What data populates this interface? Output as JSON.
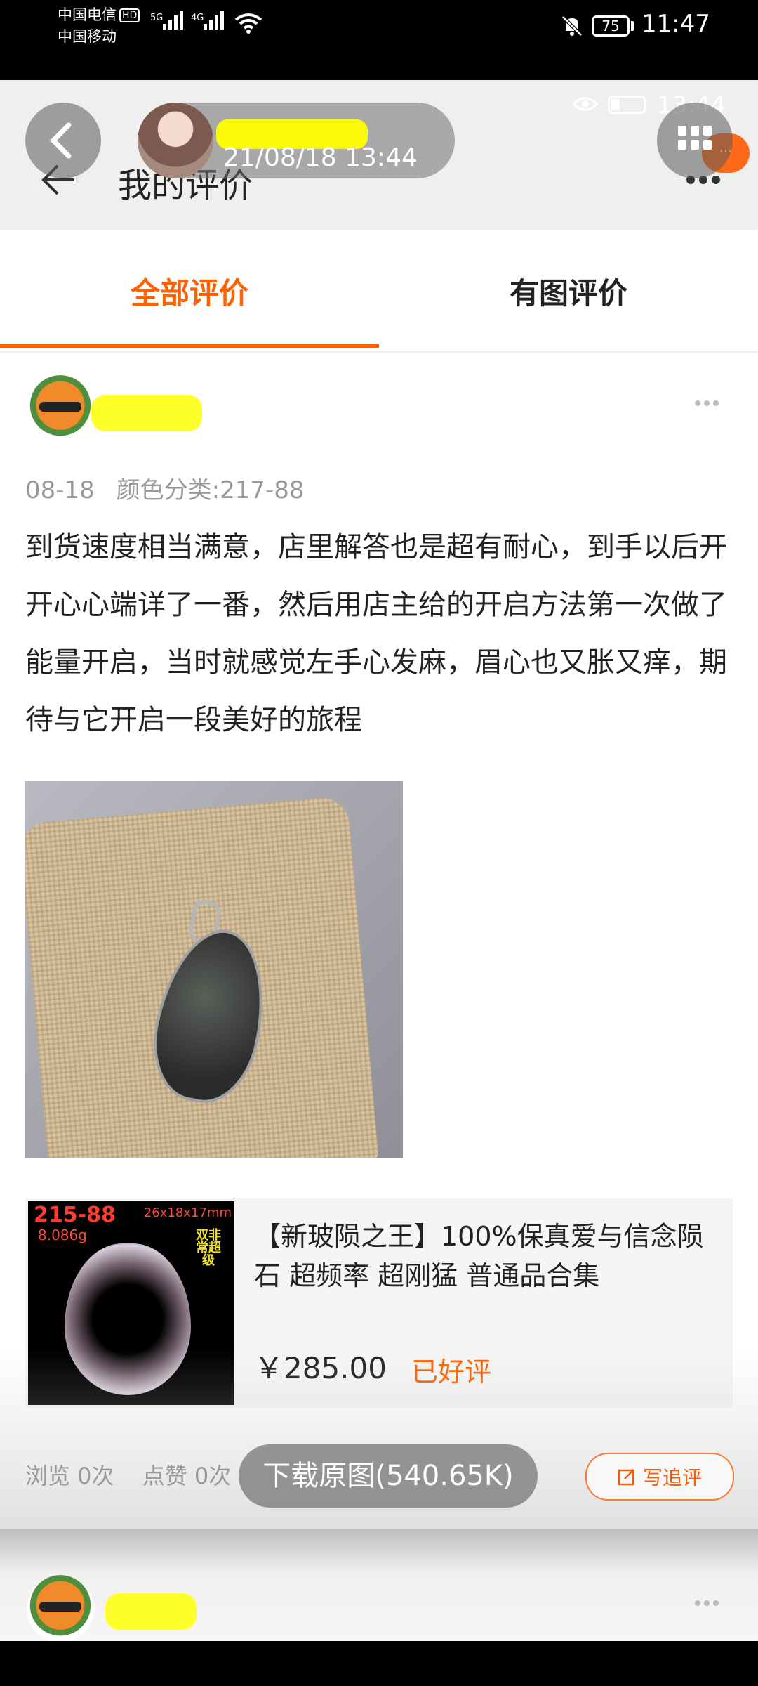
{
  "system_status": {
    "carrier_1": "中国电信",
    "carrier_1_badge": "HD",
    "carrier_2": "中国移动",
    "net_1": "5G",
    "net_2": "4G",
    "battery": "75",
    "time": "11:47"
  },
  "overlay": {
    "post_time": "21/08/18 13:44",
    "ghost_time": "13:44"
  },
  "header": {
    "title": "我的评价"
  },
  "tabs": [
    {
      "label": "全部评价",
      "active": true
    },
    {
      "label": "有图评价",
      "active": false
    }
  ],
  "review": {
    "date": "08-18",
    "variant": "颜色分类:217-88",
    "content": "到货速度相当满意，店里解答也是超有耐心，到手以后开开心心端详了一番，然后用店主给的开启方法第一次做了能量开启，当时就感觉左手心发麻，眉心也又胀又痒，期待与它开启一段美好的旅程",
    "product": {
      "image_code": "215-88",
      "image_weight": "8.086g",
      "image_size": "26x18x17mm",
      "image_stamp": "双非常超级",
      "title": "【新玻陨之王】100%保真爱与信念陨石 超频率 超刚猛 普通品合集",
      "price": "￥285.00",
      "status": "已好评"
    },
    "stats": {
      "views": "浏览 0次",
      "likes": "点赞 0次"
    },
    "download_label": "下载原图(540.65K)",
    "followup_label": "写追评"
  },
  "colors": {
    "accent": "#ff6000",
    "highlight_mask": "#ffff00"
  }
}
